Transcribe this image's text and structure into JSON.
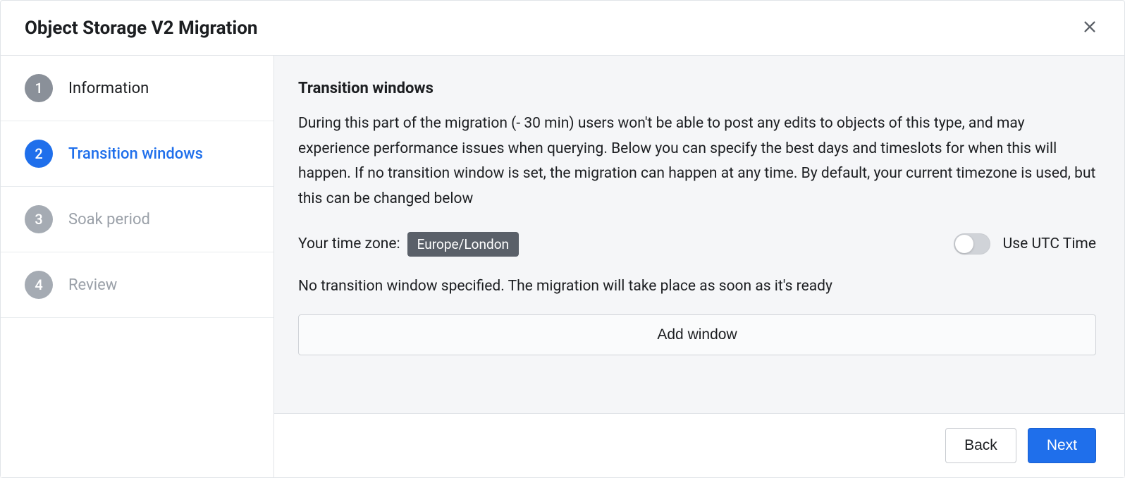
{
  "header": {
    "title": "Object Storage V2 Migration"
  },
  "steps": [
    {
      "number": "1",
      "label": "Information",
      "state": "completed"
    },
    {
      "number": "2",
      "label": "Transition windows",
      "state": "active"
    },
    {
      "number": "3",
      "label": "Soak period",
      "state": "pending"
    },
    {
      "number": "4",
      "label": "Review",
      "state": "pending"
    }
  ],
  "content": {
    "section_title": "Transition windows",
    "description": "During this part of the migration (- 30 min) users won't be able to post any edits to objects of this type, and may experience performance issues when querying. Below you can specify the best days and timeslots for when this will happen. If no transition window is set, the migration can happen at any time. By default, your current timezone is used, but this can be changed below",
    "timezone_label": "Your time zone:",
    "timezone_value": "Europe/London",
    "utc_toggle_label": "Use UTC Time",
    "utc_toggle_on": false,
    "no_window_text": "No transition window specified. The migration will take place as soon as it's ready",
    "add_window_label": "Add window"
  },
  "footer": {
    "back_label": "Back",
    "next_label": "Next"
  }
}
